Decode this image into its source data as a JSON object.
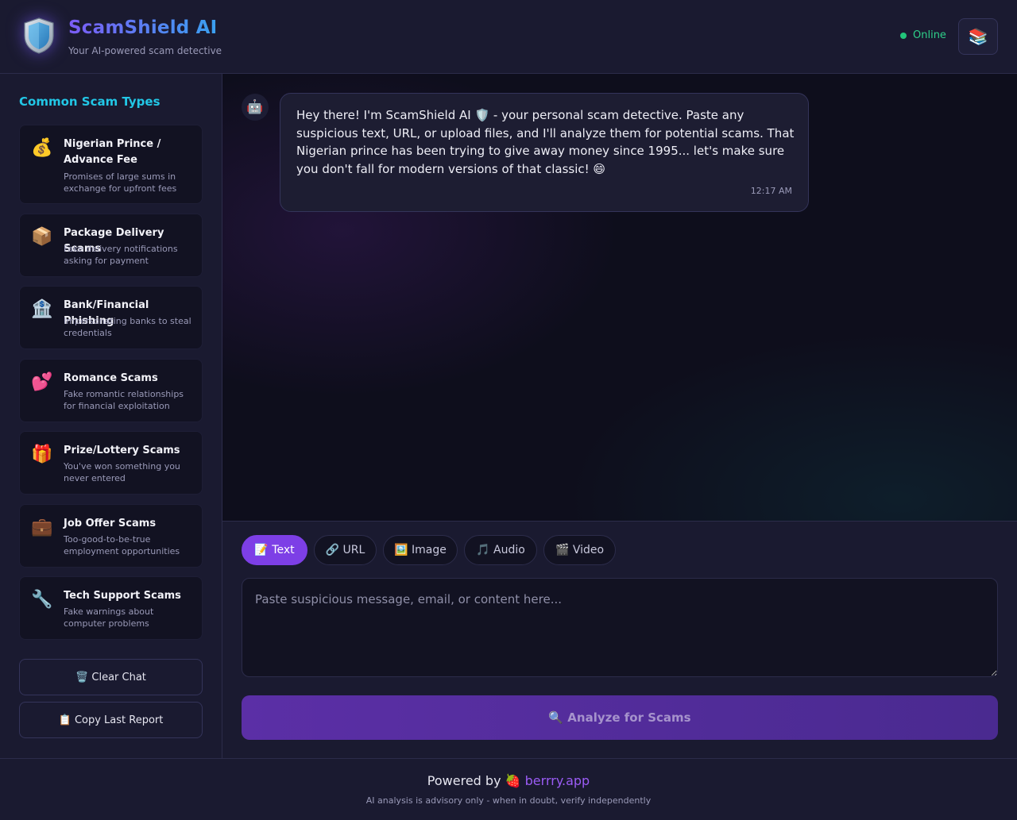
{
  "header": {
    "title": "ScamShield AI",
    "subtitle": "Your AI-powered scam detective",
    "logo_icon": "shield-icon",
    "status_label": "Online",
    "status_color": "#22c47a",
    "resources_icon": "📚"
  },
  "sidebar": {
    "title": "Common Scam Types",
    "scam_types": [
      {
        "icon": "💰",
        "name": "Nigerian Prince / Advance Fee",
        "description": "Promises of large sums in exchange for upfront fees"
      },
      {
        "icon": "📦",
        "name": "Package Delivery Scams",
        "description": "Fake delivery notifications asking for payment"
      },
      {
        "icon": "🏦",
        "name": "Bank/Financial Phishing",
        "description": "Impersonating banks to steal credentials"
      },
      {
        "icon": "💕",
        "name": "Romance Scams",
        "description": "Fake romantic relationships for financial exploitation"
      },
      {
        "icon": "🎁",
        "name": "Prize/Lottery Scams",
        "description": "You've won something you never entered"
      },
      {
        "icon": "💼",
        "name": "Job Offer Scams",
        "description": "Too-good-to-be-true employment opportunities"
      },
      {
        "icon": "🔧",
        "name": "Tech Support Scams",
        "description": "Fake warnings about computer problems"
      }
    ],
    "clear_chat_label": "🗑️ Clear Chat",
    "copy_report_label": "📋 Copy Last Report"
  },
  "chat": {
    "bot_avatar": "🤖",
    "messages": [
      {
        "text": "Hey there! I'm ScamShield AI 🛡️ - your personal scam detective. Paste any suspicious text, URL, or upload files, and I'll analyze them for potential scams. That Nigerian prince has been trying to give away money since 1995... let's make sure you don't fall for modern versions of that classic! 😄",
        "time": "12:17 AM"
      }
    ]
  },
  "input": {
    "tabs": [
      {
        "label": "📝 Text",
        "active": true
      },
      {
        "label": "🔗 URL",
        "active": false
      },
      {
        "label": "🖼️ Image",
        "active": false
      },
      {
        "label": "🎵 Audio",
        "active": false
      },
      {
        "label": "🎬 Video",
        "active": false
      }
    ],
    "placeholder": "Paste suspicious message, email, or content here...",
    "value": "",
    "analyze_label": "🔍 Analyze for Scams"
  },
  "footer": {
    "powered_prefix": "Powered by 🍓",
    "powered_brand": "berrry.app",
    "disclaimer": "AI analysis is advisory only - when in doubt, verify independently"
  },
  "colors": {
    "accent": "#7d3fe6",
    "sidebar_title": "#22c7e6",
    "background": "#15152a"
  }
}
